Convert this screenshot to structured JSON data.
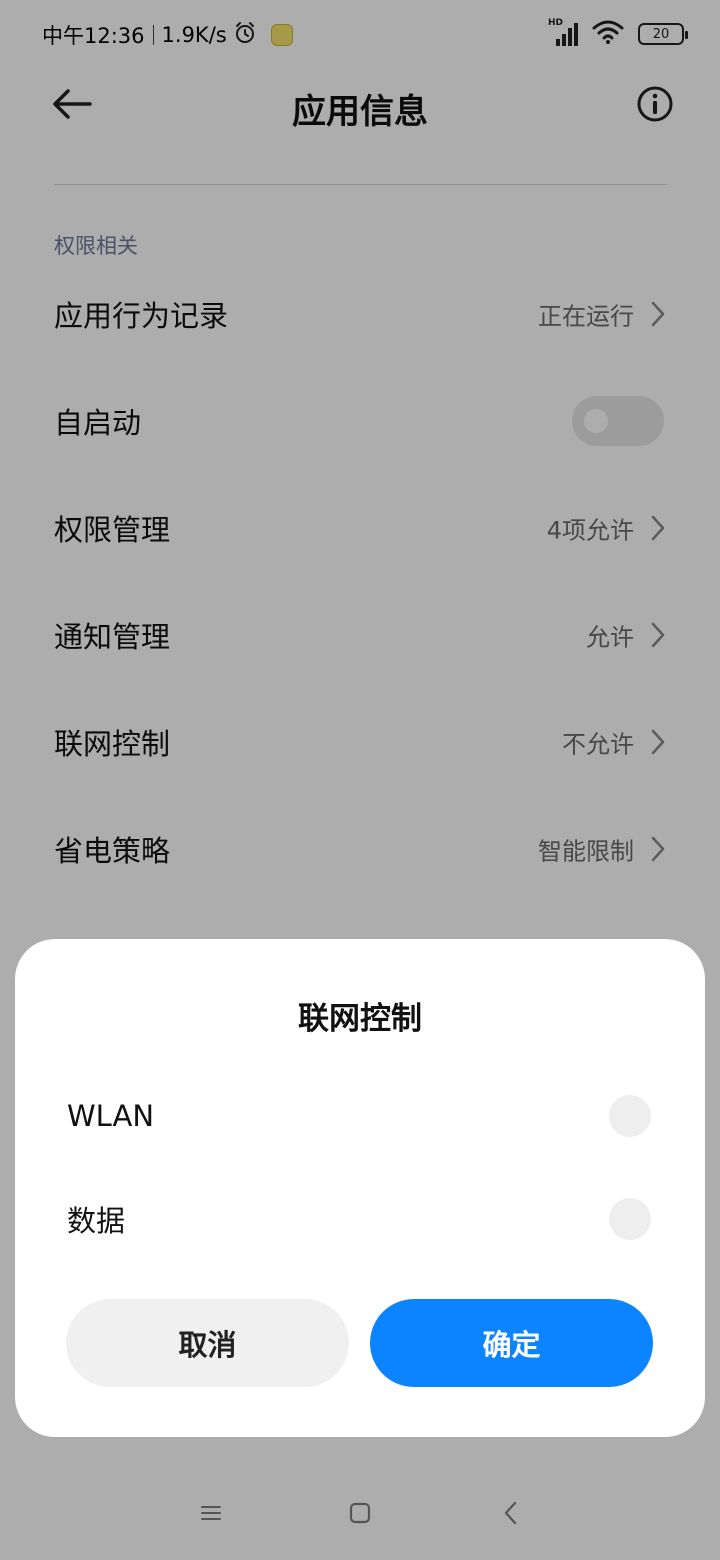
{
  "status_bar": {
    "time": "中午12:36",
    "net_speed": "1.9K/s",
    "network_type": "HD",
    "battery_level": "20",
    "icons": [
      "alarm-icon",
      "app-notification-icon",
      "signal-icon",
      "wifi-icon",
      "battery-icon"
    ]
  },
  "header": {
    "title": "应用信息",
    "back_icon": "arrow-left-icon",
    "info_icon": "info-icon"
  },
  "section": {
    "title": "权限相关"
  },
  "rows": [
    {
      "label": "应用行为记录",
      "value": "正在运行",
      "type": "link"
    },
    {
      "label": "自启动",
      "value": "",
      "type": "toggle",
      "toggle_on": false
    },
    {
      "label": "权限管理",
      "value": "4项允许",
      "type": "link"
    },
    {
      "label": "通知管理",
      "value": "允许",
      "type": "link"
    },
    {
      "label": "联网控制",
      "value": "不允许",
      "type": "link"
    },
    {
      "label": "省电策略",
      "value": "智能限制",
      "type": "link"
    }
  ],
  "dialog": {
    "title": "联网控制",
    "options": [
      {
        "label": "WLAN",
        "checked": false
      },
      {
        "label": "数据",
        "checked": false
      }
    ],
    "cancel_label": "取消",
    "ok_label": "确定"
  },
  "navbar": {
    "icons": [
      "menu-icon",
      "home-icon",
      "back-icon"
    ]
  },
  "colors": {
    "accent": "#0d84ff",
    "section_title": "#6a7a9a",
    "overlay": "rgba(0,0,0,0.32)"
  }
}
